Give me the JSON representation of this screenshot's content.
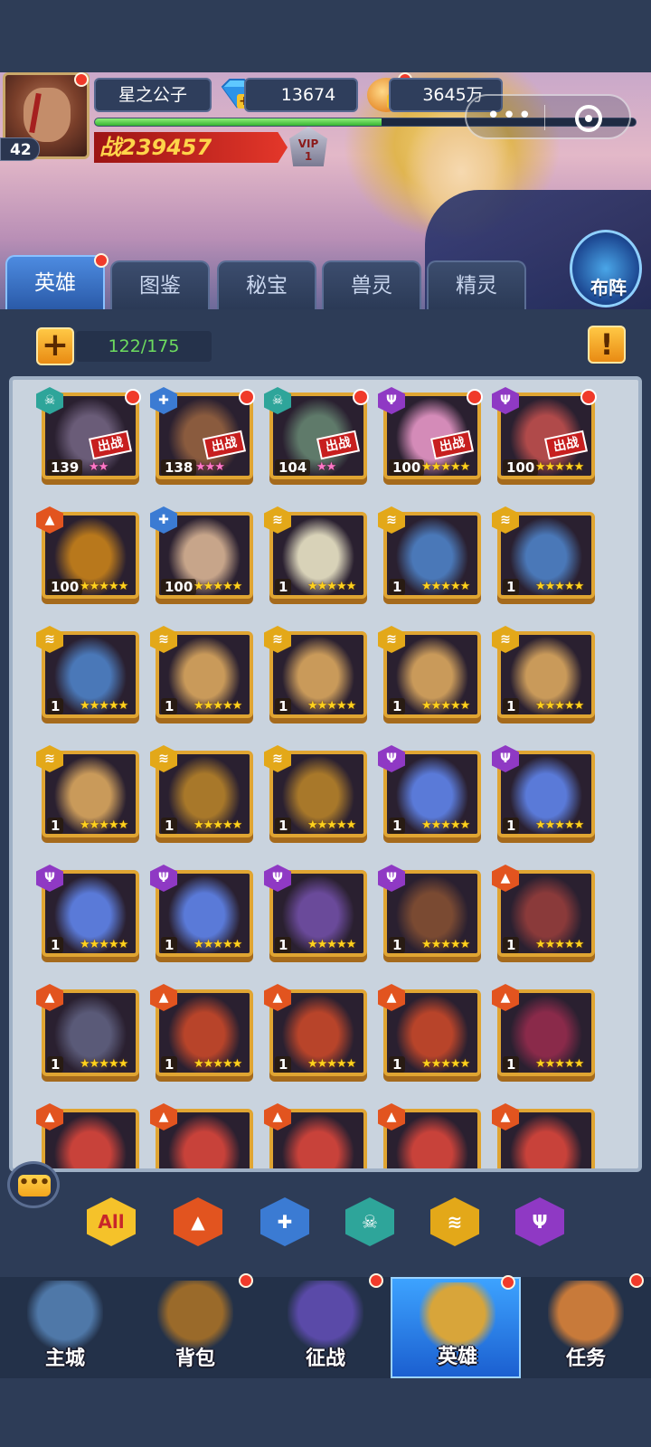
{
  "player": {
    "name": "星之公子",
    "level": "42",
    "power_prefix": "战",
    "power": "239457",
    "vip_label": "VIP",
    "vip_level": "1",
    "exp_fraction": 0.53
  },
  "currency": {
    "gems": "13674",
    "gold": "3645万"
  },
  "tabs": [
    {
      "label": "英雄",
      "active": true
    },
    {
      "label": "图鉴",
      "active": false
    },
    {
      "label": "秘宝",
      "active": false
    },
    {
      "label": "兽灵",
      "active": false
    },
    {
      "label": "精灵",
      "active": false
    }
  ],
  "formation_label": "布阵",
  "hero_count": "122/175",
  "deploy_label": "出战",
  "faction_colors": {
    "skull": "#2ea59a",
    "cross": "#3b7bd3",
    "flame": "#e2541f",
    "wing": "#e3a819",
    "trident": "#8f39c4"
  },
  "heroes": [
    {
      "faction": "skull",
      "level": "139",
      "stars": 2,
      "pink": true,
      "deployed": true,
      "dot": true,
      "color": "#6a5c78"
    },
    {
      "faction": "cross",
      "level": "138",
      "stars": 3,
      "pink": true,
      "deployed": true,
      "dot": true,
      "color": "#8a5b3e"
    },
    {
      "faction": "skull",
      "level": "104",
      "stars": 2,
      "pink": true,
      "deployed": true,
      "dot": true,
      "color": "#5f7a6a"
    },
    {
      "faction": "trident",
      "level": "100",
      "stars": 5,
      "pink": false,
      "deployed": true,
      "dot": true,
      "color": "#d48bb8"
    },
    {
      "faction": "trident",
      "level": "100",
      "stars": 5,
      "pink": false,
      "deployed": true,
      "dot": true,
      "color": "#b04a4a"
    },
    {
      "faction": "flame",
      "level": "100",
      "stars": 5,
      "pink": false,
      "deployed": false,
      "dot": false,
      "color": "#b8781c"
    },
    {
      "faction": "cross",
      "level": "100",
      "stars": 5,
      "pink": false,
      "deployed": false,
      "dot": false,
      "color": "#c7a58a"
    },
    {
      "faction": "wing",
      "level": "1",
      "stars": 5,
      "pink": false,
      "deployed": false,
      "dot": false,
      "color": "#d8d2b8"
    },
    {
      "faction": "wing",
      "level": "1",
      "stars": 5,
      "pink": false,
      "deployed": false,
      "dot": false,
      "color": "#4a78b8"
    },
    {
      "faction": "wing",
      "level": "1",
      "stars": 5,
      "pink": false,
      "deployed": false,
      "dot": false,
      "color": "#4a78b8"
    },
    {
      "faction": "wing",
      "level": "1",
      "stars": 5,
      "pink": false,
      "deployed": false,
      "dot": false,
      "color": "#4a78b8"
    },
    {
      "faction": "wing",
      "level": "1",
      "stars": 5,
      "pink": false,
      "deployed": false,
      "dot": false,
      "color": "#c99a5a"
    },
    {
      "faction": "wing",
      "level": "1",
      "stars": 5,
      "pink": false,
      "deployed": false,
      "dot": false,
      "color": "#c99a5a"
    },
    {
      "faction": "wing",
      "level": "1",
      "stars": 5,
      "pink": false,
      "deployed": false,
      "dot": false,
      "color": "#c99a5a"
    },
    {
      "faction": "wing",
      "level": "1",
      "stars": 5,
      "pink": false,
      "deployed": false,
      "dot": false,
      "color": "#c99a5a"
    },
    {
      "faction": "wing",
      "level": "1",
      "stars": 5,
      "pink": false,
      "deployed": false,
      "dot": false,
      "color": "#c99a5a"
    },
    {
      "faction": "wing",
      "level": "1",
      "stars": 5,
      "pink": false,
      "deployed": false,
      "dot": false,
      "color": "#a8782a"
    },
    {
      "faction": "wing",
      "level": "1",
      "stars": 5,
      "pink": false,
      "deployed": false,
      "dot": false,
      "color": "#a8782a"
    },
    {
      "faction": "trident",
      "level": "1",
      "stars": 5,
      "pink": false,
      "deployed": false,
      "dot": false,
      "color": "#5a7ad8"
    },
    {
      "faction": "trident",
      "level": "1",
      "stars": 5,
      "pink": false,
      "deployed": false,
      "dot": false,
      "color": "#5a7ad8"
    },
    {
      "faction": "trident",
      "level": "1",
      "stars": 5,
      "pink": false,
      "deployed": false,
      "dot": false,
      "color": "#5a7ad8"
    },
    {
      "faction": "trident",
      "level": "1",
      "stars": 5,
      "pink": false,
      "deployed": false,
      "dot": false,
      "color": "#5a7ad8"
    },
    {
      "faction": "trident",
      "level": "1",
      "stars": 5,
      "pink": false,
      "deployed": false,
      "dot": false,
      "color": "#6a4a9a"
    },
    {
      "faction": "trident",
      "level": "1",
      "stars": 5,
      "pink": false,
      "deployed": false,
      "dot": false,
      "color": "#7a4a32"
    },
    {
      "faction": "flame",
      "level": "1",
      "stars": 5,
      "pink": false,
      "deployed": false,
      "dot": false,
      "color": "#8a3a3a"
    },
    {
      "faction": "flame",
      "level": "1",
      "stars": 5,
      "pink": false,
      "deployed": false,
      "dot": false,
      "color": "#5a5a78"
    },
    {
      "faction": "flame",
      "level": "1",
      "stars": 5,
      "pink": false,
      "deployed": false,
      "dot": false,
      "color": "#b8442a"
    },
    {
      "faction": "flame",
      "level": "1",
      "stars": 5,
      "pink": false,
      "deployed": false,
      "dot": false,
      "color": "#b8442a"
    },
    {
      "faction": "flame",
      "level": "1",
      "stars": 5,
      "pink": false,
      "deployed": false,
      "dot": false,
      "color": "#b8442a"
    },
    {
      "faction": "flame",
      "level": "1",
      "stars": 5,
      "pink": false,
      "deployed": false,
      "dot": false,
      "color": "#8a2a4a"
    },
    {
      "faction": "flame",
      "level": "",
      "stars": 0,
      "pink": false,
      "deployed": false,
      "dot": false,
      "color": "#c8423a"
    },
    {
      "faction": "flame",
      "level": "",
      "stars": 0,
      "pink": false,
      "deployed": false,
      "dot": false,
      "color": "#c8423a"
    },
    {
      "faction": "flame",
      "level": "",
      "stars": 0,
      "pink": false,
      "deployed": false,
      "dot": false,
      "color": "#c8423a"
    },
    {
      "faction": "flame",
      "level": "",
      "stars": 0,
      "pink": false,
      "deployed": false,
      "dot": false,
      "color": "#c8423a"
    },
    {
      "faction": "flame",
      "level": "",
      "stars": 0,
      "pink": false,
      "deployed": false,
      "dot": false,
      "color": "#c8423a"
    }
  ],
  "filters": [
    {
      "name": "all",
      "label": "All",
      "color": "#f5c22a"
    },
    {
      "name": "flame",
      "label": "",
      "color": "#e2541f"
    },
    {
      "name": "cross",
      "label": "",
      "color": "#3b7bd3"
    },
    {
      "name": "skull",
      "label": "",
      "color": "#2ea59a"
    },
    {
      "name": "wing",
      "label": "",
      "color": "#e3a819"
    },
    {
      "name": "trident",
      "label": "",
      "color": "#8f39c4"
    }
  ],
  "nav": [
    {
      "label": "主城",
      "dot": false,
      "active": false,
      "color": "#4f78a8"
    },
    {
      "label": "背包",
      "dot": true,
      "active": false,
      "color": "#9a6a2a"
    },
    {
      "label": "征战",
      "dot": true,
      "active": false,
      "color": "#5a4aa8"
    },
    {
      "label": "英雄",
      "dot": true,
      "active": true,
      "color": "#d8a53a"
    },
    {
      "label": "任务",
      "dot": true,
      "active": false,
      "color": "#c87a3a"
    }
  ]
}
